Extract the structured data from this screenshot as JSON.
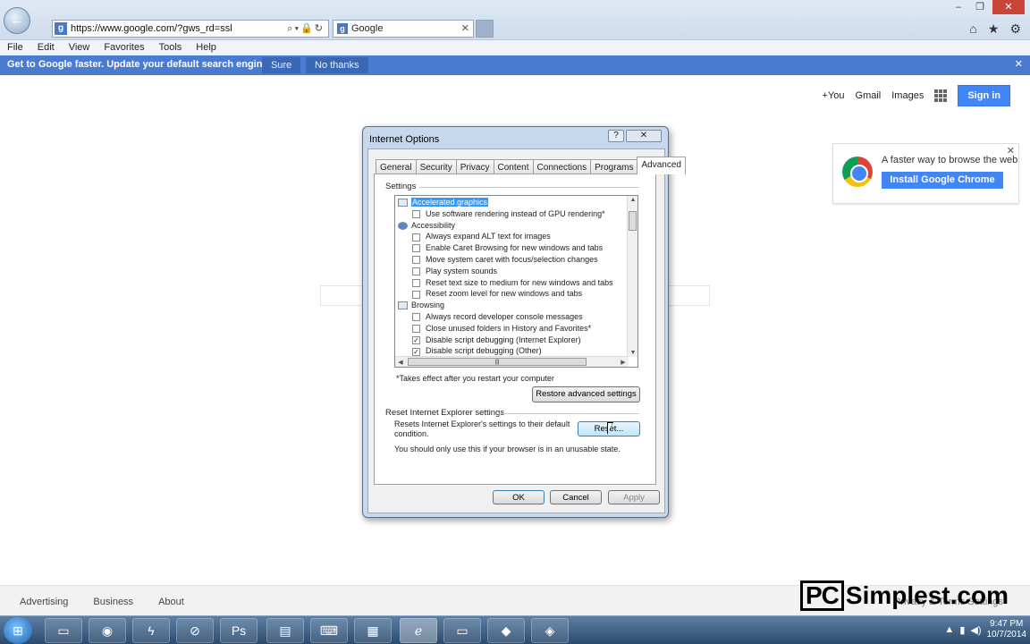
{
  "browser": {
    "address": "https://www.google.com/?gws_rd=ssl",
    "address_icon_letter": "g",
    "tab_title": "Google",
    "tab_icon_letter": "g",
    "controls": {
      "minimize": "–",
      "maximize": "❐",
      "close": "✕"
    },
    "right_icons": [
      "home-icon",
      "star-icon",
      "gear-icon"
    ],
    "menu": [
      "File",
      "Edit",
      "View",
      "Favorites",
      "Tools",
      "Help"
    ],
    "notification": {
      "text": "Get to Google faster. Update your default search engine.",
      "sure": "Sure",
      "no_thanks": "No thanks",
      "close": "✕"
    }
  },
  "google": {
    "links": {
      "you": "+You",
      "gmail": "Gmail",
      "images": "Images",
      "sign_in": "Sign in"
    },
    "promo": {
      "text": "A faster way to browse the web",
      "button": "Install Google Chrome",
      "close": "✕"
    },
    "footer": {
      "advertising": "Advertising",
      "business": "Business",
      "about": "About",
      "right": "Privacy & Terms    Settings"
    }
  },
  "dialog": {
    "title": "Internet Options",
    "help": "?",
    "close": "✕",
    "tabs": [
      "General",
      "Security",
      "Privacy",
      "Content",
      "Connections",
      "Programs",
      "Advanced"
    ],
    "active_tab": "Advanced",
    "settings_label": "Settings",
    "tree": [
      {
        "type": "cat",
        "label": "Accelerated graphics",
        "selected": true
      },
      {
        "type": "opt",
        "label": "Use software rendering instead of GPU rendering*",
        "checked": false
      },
      {
        "type": "cat",
        "label": "Accessibility",
        "round": true
      },
      {
        "type": "opt",
        "label": "Always expand ALT text for images",
        "checked": false
      },
      {
        "type": "opt",
        "label": "Enable Caret Browsing for new windows and tabs",
        "checked": false
      },
      {
        "type": "opt",
        "label": "Move system caret with focus/selection changes",
        "checked": false
      },
      {
        "type": "opt",
        "label": "Play system sounds",
        "checked": false
      },
      {
        "type": "opt",
        "label": "Reset text size to medium for new windows and tabs",
        "checked": false
      },
      {
        "type": "opt",
        "label": "Reset zoom level for new windows and tabs",
        "checked": false
      },
      {
        "type": "cat",
        "label": "Browsing"
      },
      {
        "type": "opt",
        "label": "Always record developer console messages",
        "checked": false
      },
      {
        "type": "opt",
        "label": "Close unused folders in History and Favorites*",
        "checked": false
      },
      {
        "type": "opt",
        "label": "Disable script debugging (Internet Explorer)",
        "checked": true
      },
      {
        "type": "opt",
        "label": "Disable script debugging (Other)",
        "checked": true
      }
    ],
    "note": "*Takes effect after you restart your computer",
    "restore_button": "Restore advanced settings",
    "reset_section": "Reset Internet Explorer settings",
    "reset_desc": "Resets Internet Explorer's settings to their default condition.",
    "reset_button": "Reset...",
    "unusable_note": "You should only use this if your browser is in an unusable state.",
    "ok": "OK",
    "cancel": "Cancel",
    "apply": "Apply"
  },
  "watermark": {
    "box": "PC",
    "rest": "Simplest.com"
  },
  "taskbar": {
    "apps": [
      "folder-icon",
      "chrome-icon",
      "app-icon",
      "app-icon",
      "photoshop-icon",
      "app-icon",
      "app-icon",
      "calculator-icon",
      "internet-explorer-icon",
      "folder-icon",
      "app-icon",
      "app-icon"
    ],
    "ps_label": "Ps",
    "time": "9:47 PM",
    "date": "10/7/2014"
  }
}
